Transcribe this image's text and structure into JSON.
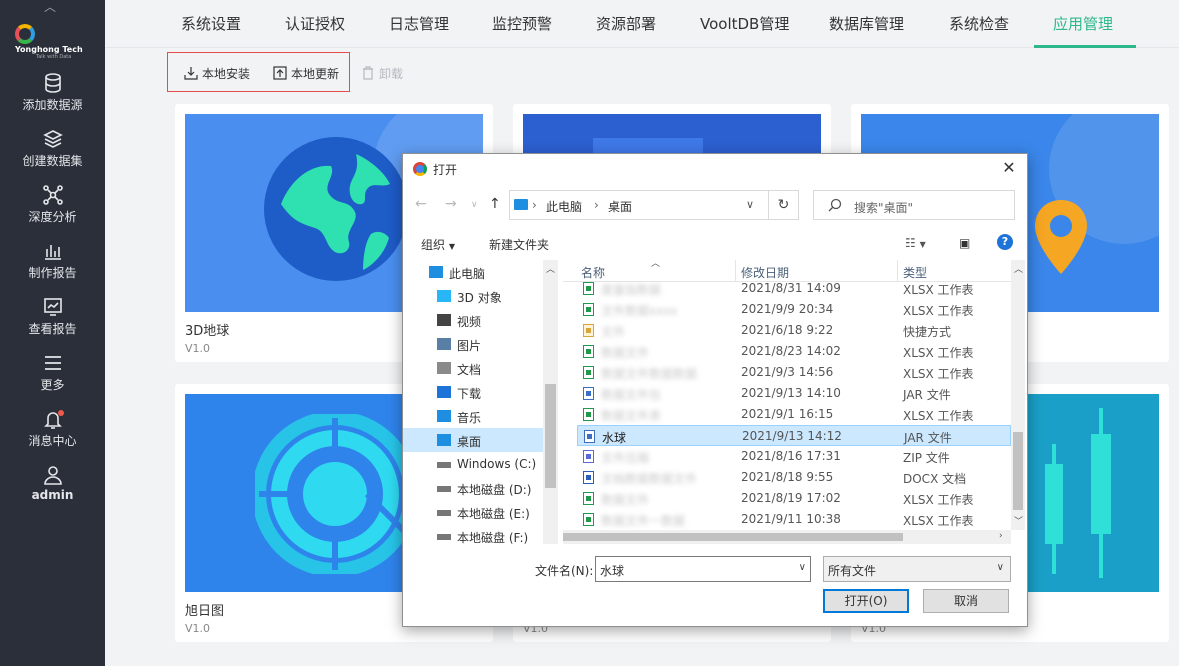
{
  "sidebar": {
    "logo_text": "Yonghong Tech",
    "logo_tagline": "Talk with Data",
    "items": [
      {
        "label": "添加数据源"
      },
      {
        "label": "创建数据集"
      },
      {
        "label": "深度分析"
      },
      {
        "label": "制作报告"
      },
      {
        "label": "查看报告"
      },
      {
        "label": "更多"
      },
      {
        "label": "消息中心"
      },
      {
        "label": "admin"
      }
    ]
  },
  "tabs": [
    {
      "label": "系统设置"
    },
    {
      "label": "认证授权"
    },
    {
      "label": "日志管理"
    },
    {
      "label": "监控预警"
    },
    {
      "label": "资源部署"
    },
    {
      "label": "VooltDB管理"
    },
    {
      "label": "数据库管理"
    },
    {
      "label": "系统检查"
    },
    {
      "label": "应用管理",
      "active": true
    }
  ],
  "toolbar": {
    "install_label": "本地安装",
    "update_label": "本地更新",
    "uninstall_label": "卸载"
  },
  "cards": [
    {
      "name": "3D地球",
      "version": "V1.0"
    },
    {
      "name": "",
      "version": ""
    },
    {
      "name": "",
      "version": ""
    },
    {
      "name": "旭日图",
      "version": "V1.0"
    },
    {
      "name": "",
      "version": "V1.0"
    },
    {
      "name": "",
      "version": "V1.0"
    }
  ],
  "dialog": {
    "title": "打开",
    "address": {
      "seg1": "此电脑",
      "seg2": "桌面"
    },
    "search_placeholder": "搜索\"桌面\"",
    "organize_label": "组织",
    "new_folder_label": "新建文件夹",
    "tree": [
      {
        "label": "此电脑",
        "icon": "computer"
      },
      {
        "label": "3D 对象",
        "icon": "cube"
      },
      {
        "label": "视频",
        "icon": "video"
      },
      {
        "label": "图片",
        "icon": "picture"
      },
      {
        "label": "文档",
        "icon": "document"
      },
      {
        "label": "下载",
        "icon": "download"
      },
      {
        "label": "音乐",
        "icon": "music"
      },
      {
        "label": "桌面",
        "icon": "desktop",
        "selected": true
      },
      {
        "label": "Windows (C:)",
        "icon": "drive"
      },
      {
        "label": "本地磁盘 (D:)",
        "icon": "drive"
      },
      {
        "label": "本地磁盘 (E:)",
        "icon": "drive"
      },
      {
        "label": "本地磁盘 (F:)",
        "icon": "drive"
      }
    ],
    "columns": {
      "name": "名称",
      "date": "修改日期",
      "type": "类型"
    },
    "files": [
      {
        "name": "度量指数据",
        "date": "2021/8/31 14:09",
        "type": "XLSX 工作表",
        "kind": "xlsx",
        "blur": true
      },
      {
        "name": "文件数据xxxx",
        "date": "2021/9/9 20:34",
        "type": "XLSX 工作表",
        "kind": "xlsx",
        "blur": true
      },
      {
        "name": "文件",
        "date": "2021/6/18 9:22",
        "type": "快捷方式",
        "kind": "lnk",
        "blur": true
      },
      {
        "name": "数据文件",
        "date": "2021/8/23 14:02",
        "type": "XLSX 工作表",
        "kind": "xlsx",
        "blur": true
      },
      {
        "name": "数据文件数据数据",
        "date": "2021/9/3 14:56",
        "type": "XLSX 工作表",
        "kind": "xlsx",
        "blur": true
      },
      {
        "name": "数据文件包",
        "date": "2021/9/13 14:10",
        "type": "JAR 文件",
        "kind": "jar",
        "blur": true
      },
      {
        "name": "数据文件表",
        "date": "2021/9/1 16:15",
        "type": "XLSX 工作表",
        "kind": "xlsx",
        "blur": true
      },
      {
        "name": "水球",
        "date": "2021/9/13 14:12",
        "type": "JAR 文件",
        "kind": "jar",
        "blur": false,
        "selected": true
      },
      {
        "name": "文件压缩",
        "date": "2021/8/16 17:31",
        "type": "ZIP 文件",
        "kind": "zip",
        "blur": true
      },
      {
        "name": "文档数据数据文件",
        "date": "2021/8/18 9:55",
        "type": "DOCX 文档",
        "kind": "docx",
        "blur": true
      },
      {
        "name": "数据文件",
        "date": "2021/8/19 17:02",
        "type": "XLSX 工作表",
        "kind": "xlsx",
        "blur": true
      },
      {
        "name": "数据文件一数据",
        "date": "2021/9/11 10:38",
        "type": "XLSX 工作表",
        "kind": "xlsx",
        "blur": true
      }
    ],
    "filename_label": "文件名(N):",
    "filename_value": "水球",
    "filetype_value": "所有文件",
    "open_label": "打开(O)",
    "cancel_label": "取消"
  }
}
